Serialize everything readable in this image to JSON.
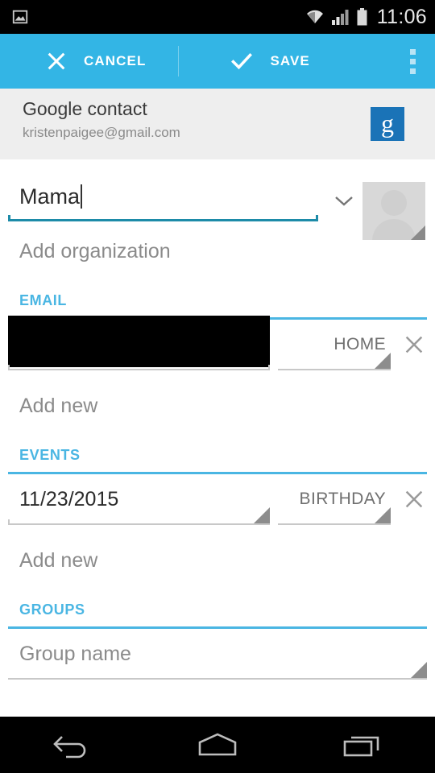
{
  "status_bar": {
    "notification_icon": "image-notification-icon",
    "wifi_icon": "wifi-icon",
    "signal_icon": "cell-signal-icon",
    "battery_icon": "battery-icon",
    "clock": "11:06"
  },
  "action_bar": {
    "cancel_label": "CANCEL",
    "cancel_icon": "close-icon",
    "save_label": "SAVE",
    "save_icon": "checkmark-icon",
    "overflow_icon": "overflow-menu-icon",
    "background_color": "#33b5e5"
  },
  "account": {
    "title": "Google contact",
    "email": "kristenpaigee@gmail.com",
    "badge_icon": "google-g-icon",
    "badge_letter": "g",
    "badge_color": "#1a73b7"
  },
  "name_field": {
    "value": "Mama",
    "expand_icon": "chevron-down-icon",
    "avatar_icon": "contact-avatar-placeholder",
    "underline_color": "#1d8ba8"
  },
  "organization": {
    "add_label": "Add organization"
  },
  "sections": [
    {
      "label": "EMAIL",
      "value": "",
      "value_redacted": true,
      "type_label": "HOME",
      "delete_icon": "close-icon",
      "add_new_label": "Add new"
    },
    {
      "label": "EVENTS",
      "value": "11/23/2015",
      "value_redacted": false,
      "type_label": "BIRTHDAY",
      "delete_icon": "close-icon",
      "add_new_label": "Add new"
    },
    {
      "label": "GROUPS",
      "group_placeholder": "Group name"
    }
  ],
  "nav_bar": {
    "back_icon": "back-arrow-icon",
    "home_icon": "home-icon",
    "recents_icon": "recent-apps-icon"
  },
  "colors": {
    "accent": "#33b5e5",
    "section_header": "#4ab6e3",
    "focused_underline": "#1d8ba8",
    "hint_text": "#8b8b8b"
  }
}
